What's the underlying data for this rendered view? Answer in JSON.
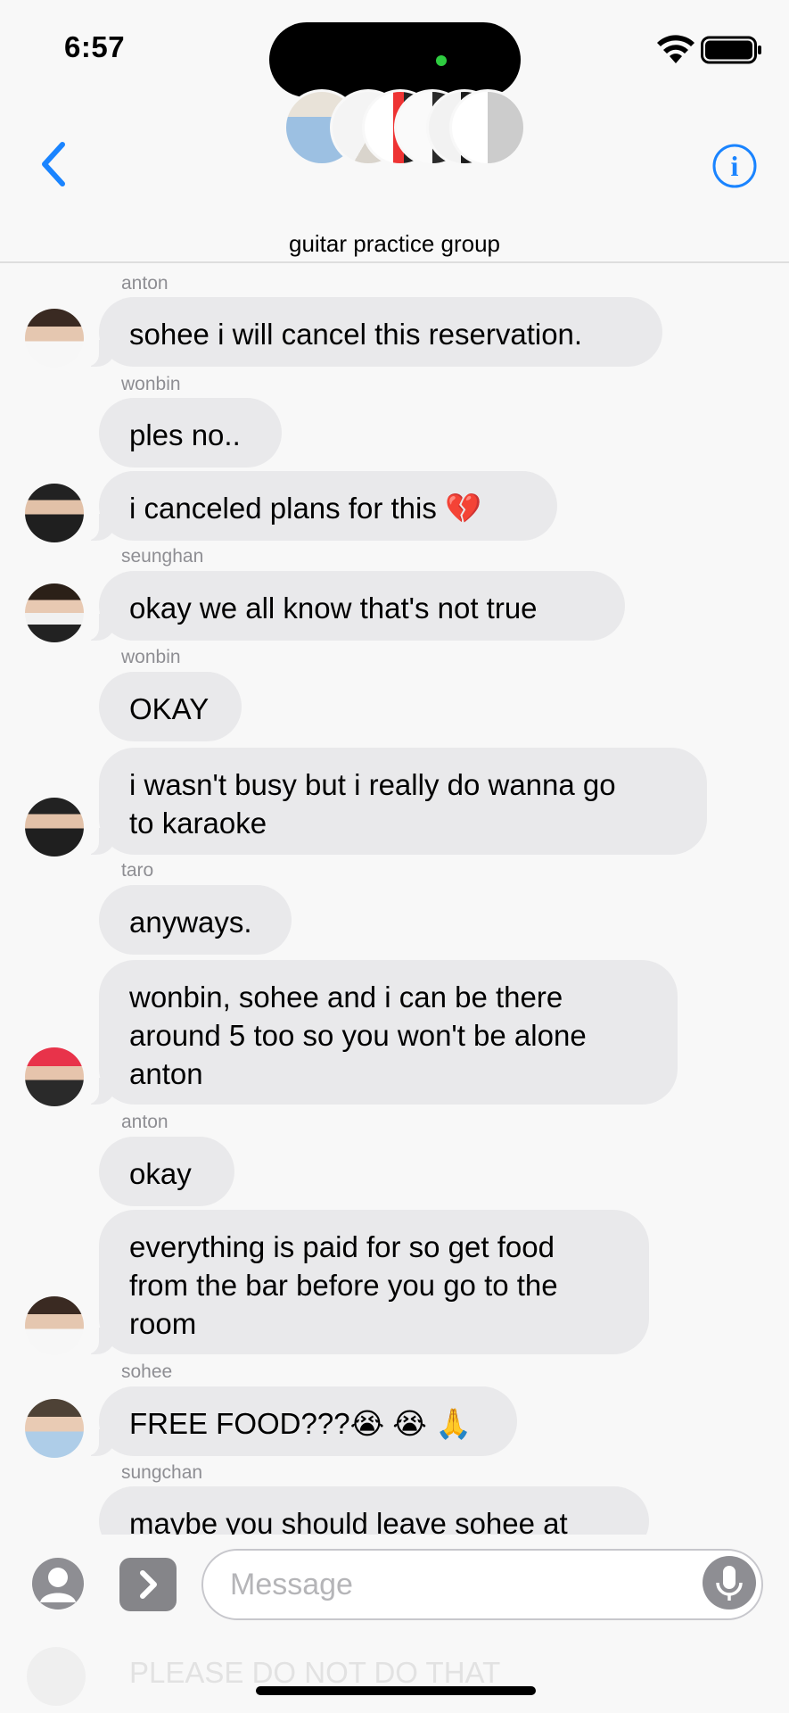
{
  "status": {
    "time": "6:57"
  },
  "header": {
    "title": "guitar practice group",
    "back_icon": "chevron-left-icon",
    "info_icon": "info-circle-icon",
    "accent_color": "#1a84ff"
  },
  "messages": [
    {
      "sender": "anton",
      "lines": [
        "sohee i will cancel this reservation."
      ],
      "avatar": "anton"
    },
    {
      "sender": "wonbin",
      "lines": [
        "ples no.."
      ],
      "avatar": ""
    },
    {
      "sender": "",
      "lines": [
        "i canceled plans for this 💔"
      ],
      "avatar": "wonbin"
    },
    {
      "sender": "seunghan",
      "lines": [
        "okay we all know that's not true"
      ],
      "avatar": "seunghan"
    },
    {
      "sender": "wonbin",
      "lines": [
        "OKAY"
      ],
      "avatar": ""
    },
    {
      "sender": "",
      "lines": [
        "i wasn't busy but i really do wanna go",
        "to karaoke"
      ],
      "avatar": "wonbin"
    },
    {
      "sender": "taro",
      "lines": [
        "anyways."
      ],
      "avatar": ""
    },
    {
      "sender": "",
      "lines": [
        "wonbin, sohee and i can be there",
        "around 5 too so you won't be alone",
        "anton"
      ],
      "avatar": "taro"
    },
    {
      "sender": "anton",
      "lines": [
        "okay"
      ],
      "avatar": ""
    },
    {
      "sender": "",
      "lines": [
        "everything is paid for so get food",
        "from the bar before you go to the",
        "room"
      ],
      "avatar": "anton"
    },
    {
      "sender": "sohee",
      "lines": [
        "FREE FOOD???😭 😭 🙏"
      ],
      "avatar": "sohee"
    },
    {
      "sender": "sungchan",
      "lines": [
        "maybe you should leave sohee at"
      ],
      "avatar": ""
    }
  ],
  "compose": {
    "placeholder": "Message",
    "contact_icon": "person-circle-icon",
    "apps_icon": "chevron-right-icon",
    "mic_icon": "microphone-icon",
    "ghost_text": "PLEASE DO NOT DO THAT"
  }
}
